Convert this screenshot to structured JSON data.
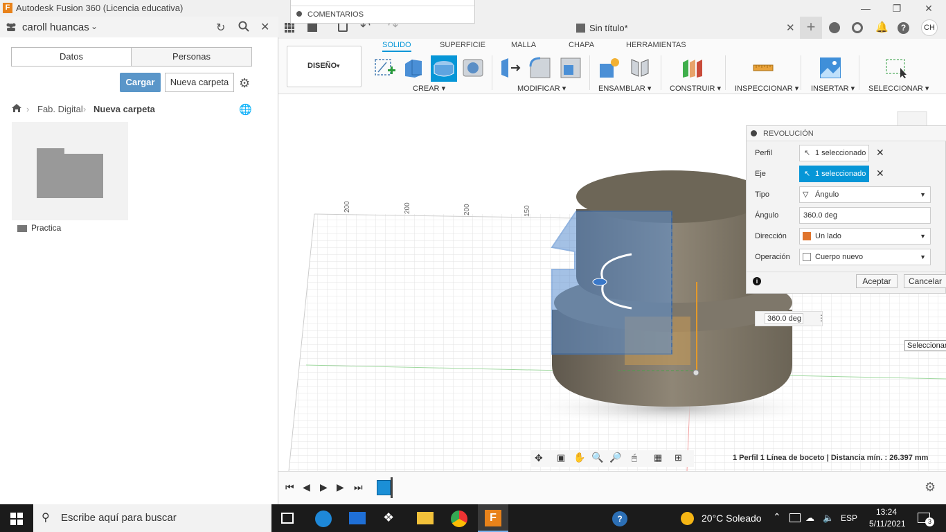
{
  "window": {
    "title": "Autodesk Fusion 360 (Licencia educativa)"
  },
  "left_panel": {
    "user": "caroll huancas",
    "tabs": [
      "Datos",
      "Personas"
    ],
    "upload_button": "Cargar",
    "new_folder_button": "Nueva carpeta",
    "breadcrumb": [
      "Fab. Digital",
      "Nueva carpeta"
    ],
    "folder_name": "Practica"
  },
  "browser_menu": {
    "comments": "COMENTARIOS"
  },
  "doc": {
    "title": "Sin título*",
    "avatar": "CH"
  },
  "ribbon": {
    "workspace": "DISEÑO",
    "tabs": [
      "SOLIDO",
      "SUPERFICIE",
      "MALLA",
      "CHAPA",
      "HERRAMIENTAS"
    ],
    "active_tab": "SOLIDO",
    "groups": [
      "CREAR",
      "MODIFICAR",
      "ENSAMBLAR",
      "CONSTRUIR",
      "INSPECCIONAR",
      "INSERTAR",
      "SELECCIONAR"
    ]
  },
  "ruler_labels": [
    "200",
    "200",
    "200",
    "150"
  ],
  "dialog": {
    "title": "REVOLUCIÓN",
    "rows": {
      "perfil": {
        "label": "Perfil",
        "value": "1 seleccionado"
      },
      "eje": {
        "label": "Eje",
        "value": "1 seleccionado"
      },
      "tipo": {
        "label": "Tipo",
        "value": "Ángulo"
      },
      "angulo": {
        "label": "Ángulo",
        "value": "360.0 deg"
      },
      "direccion": {
        "label": "Dirección",
        "value": "Un lado"
      },
      "operacion": {
        "label": "Operación",
        "value": "Cuerpo nuevo"
      }
    },
    "ok": "Aceptar",
    "cancel": "Cancelar"
  },
  "canvas": {
    "angle_input": "360.0 deg",
    "tooltip": "Seleccionar",
    "status": "1 Perfil 1 Línea de boceto | Distancia mín. : 26.397 mm"
  },
  "taskbar": {
    "search_placeholder": "Escribe aquí para buscar",
    "weather": "20°C  Soleado",
    "lang": "ESP",
    "time": "13:24",
    "date": "5/11/2021",
    "notifications": "3"
  },
  "colors": {
    "accent": "#0696d7",
    "upload_button": "#5a96c9",
    "cylinder": "#8a8172",
    "profile": "#5b8fd0"
  }
}
